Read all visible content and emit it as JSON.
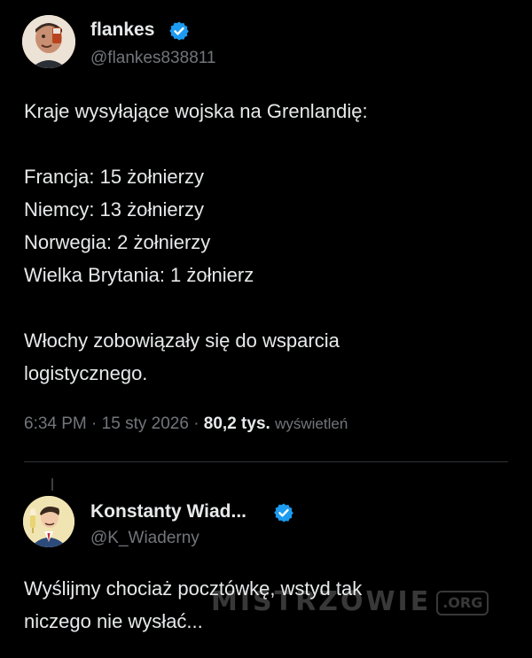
{
  "tweet": {
    "author_name": "flankes",
    "author_handle": "@flankes838811",
    "verified_icon": "verified-badge-icon",
    "lines": [
      "Kraje wysyłające wojska na Grenlandię:",
      "",
      "Francja: 15 żołnierzy",
      "Niemcy: 13 żołnierzy",
      "Norwegia: 2 żołnierzy",
      "Wielka Brytania: 1 żołnierz",
      "",
      "Włochy zobowiązały się do wsparcia",
      "logistycznego."
    ],
    "time": "6:34 PM",
    "separator": "·",
    "date": "15 sty 2026",
    "views_count": "80,2 tys.",
    "views_label": "wyświetleń"
  },
  "reply": {
    "author_name": "Konstanty Wiad...",
    "author_handle": "@K_Wiaderny",
    "verified_icon": "verified-badge-icon",
    "lines": [
      "Wyślijmy chociaż pocztówkę, wstyd tak",
      "niczego nie wysłać..."
    ]
  },
  "watermark": {
    "text": "MISTRZOWIE",
    "badge": ".ORG"
  },
  "colors": {
    "background": "#000000",
    "text_primary": "#e7e9ea",
    "text_secondary": "#71767b",
    "divider": "#2f3336",
    "verified": "#1d9bf0"
  }
}
